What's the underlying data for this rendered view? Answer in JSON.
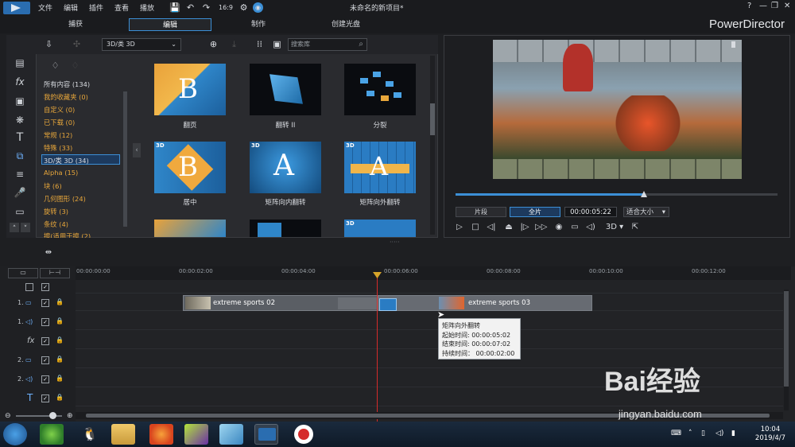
{
  "menu": [
    "文件",
    "编辑",
    "插件",
    "查看",
    "播放"
  ],
  "window": {
    "title": "未命名的新项目*",
    "help": "?",
    "minimize": "—",
    "restore": "❐",
    "close": "✕"
  },
  "modes": [
    {
      "label": "捕获"
    },
    {
      "label": "编辑"
    },
    {
      "label": "制作"
    },
    {
      "label": "创建光盘"
    }
  ],
  "brand": "PowerDirector",
  "library": {
    "category_select": "3D/类 3D",
    "search_placeholder": "搜索库",
    "categories": [
      "所有内容 (134)",
      "我的收藏夹 (0)",
      "自定义 (0)",
      "已下载 (0)",
      "常规 (12)",
      "特殊 (33)",
      "3D/类 3D (34)",
      "Alpha (15)",
      "块 (6)",
      "几何图形 (24)",
      "旋转 (3)",
      "条纹 (4)",
      "擦(适用于擦 (2)"
    ],
    "thumbs": [
      {
        "label": "翻页",
        "badge": ""
      },
      {
        "label": "翻转 II",
        "badge": ""
      },
      {
        "label": "分裂",
        "badge": ""
      },
      {
        "label": "居中",
        "badge": "3D"
      },
      {
        "label": "矩阵向内翻转",
        "badge": "3D"
      },
      {
        "label": "矩阵向外翻转",
        "badge": "3D"
      }
    ]
  },
  "preview": {
    "clip_btn": "片段",
    "movie_btn": "全片",
    "timecode": "00:00:05:22",
    "fit": "适合大小",
    "mode3d": "3D",
    "progress": 0.58
  },
  "timeline": {
    "ruler": [
      "00:00:00:00",
      "00:00:02:00",
      "00:00:04:00",
      "00:00:06:00",
      "00:00:08:00",
      "00:00:10:00",
      "00:00:12:00"
    ],
    "tracks": [
      "1.",
      "1.",
      "fx",
      "2.",
      "2.",
      "T",
      "♪"
    ],
    "clip1": "extreme sports 02",
    "clip2": "extreme sports 03",
    "tooltip": {
      "name": "矩阵向外翻转",
      "start": "起始时间: 00:00:05:02",
      "end": "结束时间: 00:00:07:02",
      "duration": "持续时间：  00:00:02:00"
    }
  },
  "taskbar": {
    "time": "10:04",
    "date": "2019/4/7"
  },
  "watermark": {
    "main": "Bai经验",
    "sub": "jingyan.baidu.com"
  }
}
